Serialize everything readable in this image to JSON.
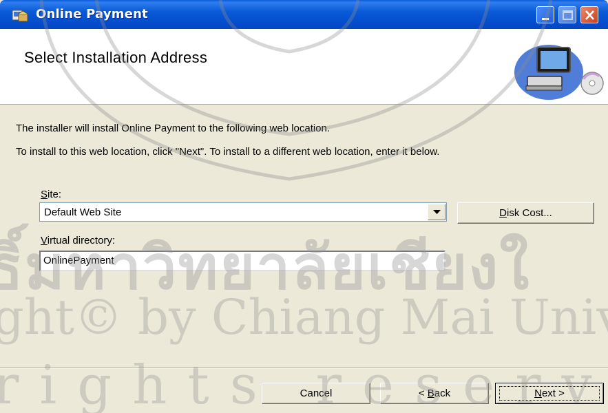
{
  "window": {
    "title": "Online Payment",
    "buttons": {
      "minimize": "minimize",
      "maximize": "maximize",
      "close": "close"
    }
  },
  "banner": {
    "title": "Select Installation Address",
    "art_icon": "computer-cd-icon"
  },
  "body": {
    "line1": "The installer will install Online Payment to the following web location.",
    "line2": "To install to this web location, click \"Next\". To install to a different web location, enter it below."
  },
  "site": {
    "label_mnemonic": "S",
    "label_rest": "ite:",
    "value": "Default Web Site"
  },
  "vdir": {
    "label_mnemonic": "V",
    "label_rest": "irtual directory:",
    "value": "OnlinePayment"
  },
  "buttons": {
    "disk_cost_mnemonic": "D",
    "disk_cost_rest": "isk Cost...",
    "cancel": "Cancel",
    "back_prefix": "< ",
    "back_mnemonic": "B",
    "back_rest": "ack",
    "next_mnemonic": "N",
    "next_rest": "ext >"
  },
  "watermark": {
    "thai": "ธิ์มหาวิทยาลัยเชียงใ",
    "copyright": "ght© by Chiang Mai Unive",
    "rights": "rights reserv"
  },
  "colors": {
    "titlebar": "#0a5ad6",
    "face": "#ece9d8"
  }
}
